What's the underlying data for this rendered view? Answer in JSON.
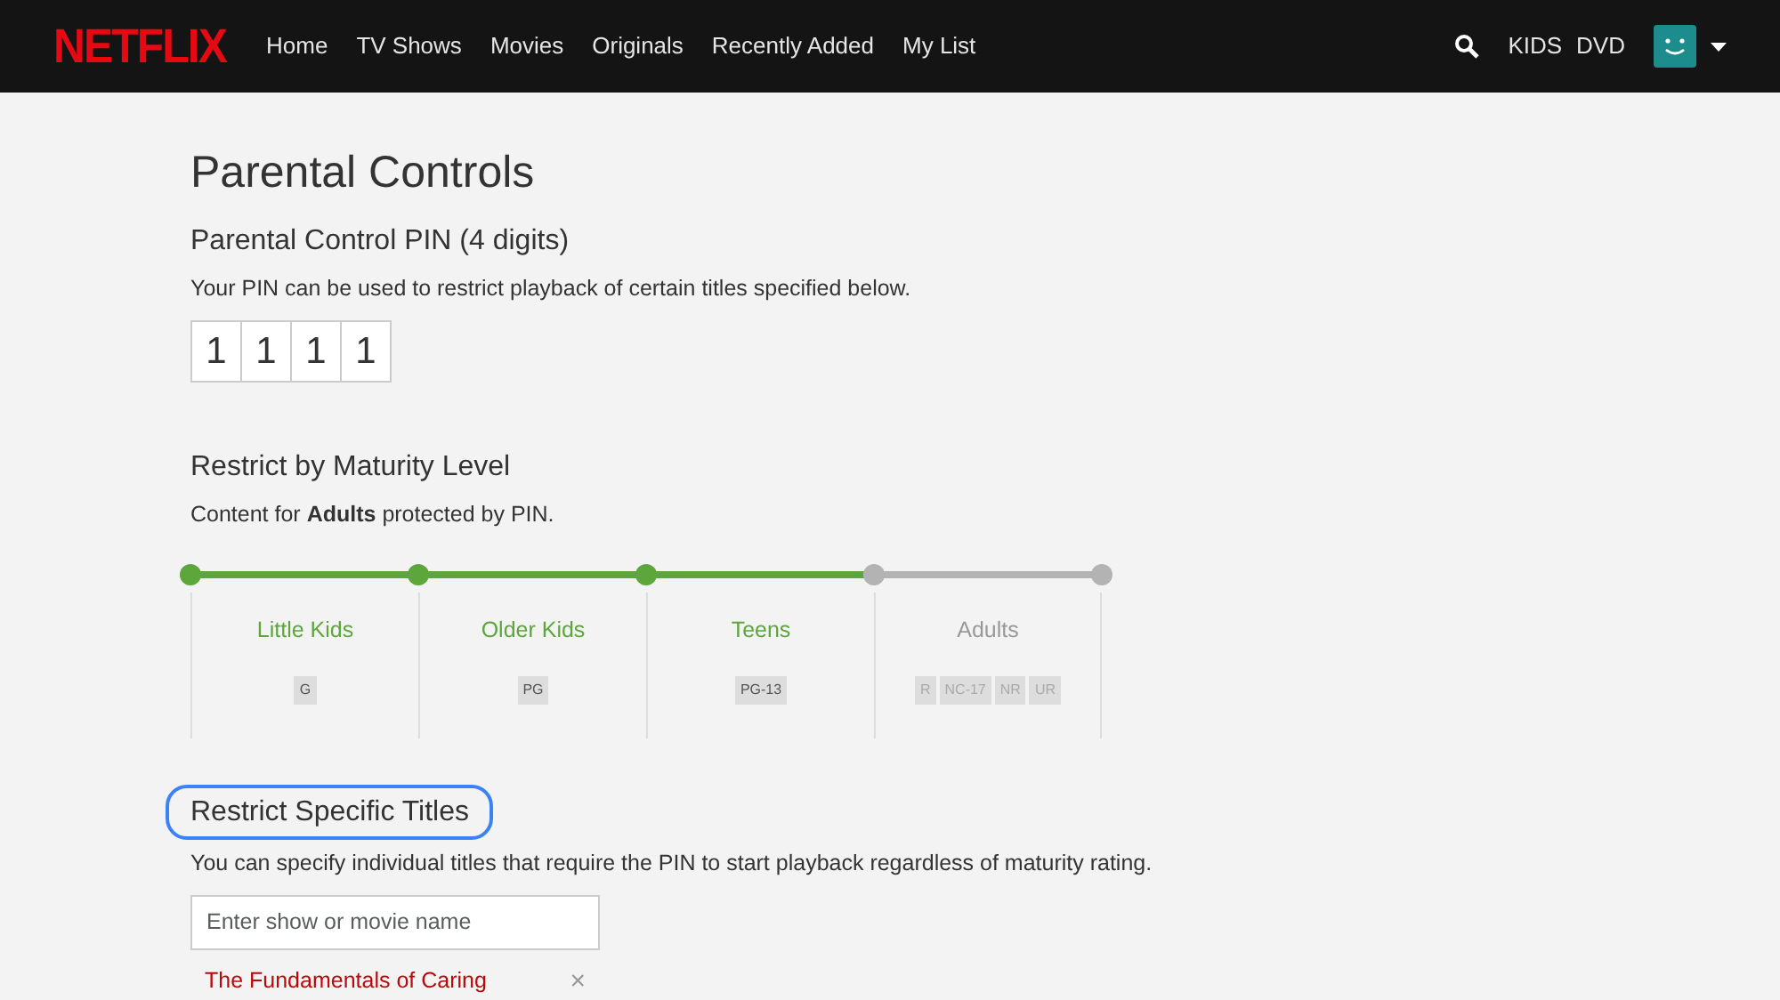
{
  "header": {
    "logo": "NETFLIX",
    "nav": [
      "Home",
      "TV Shows",
      "Movies",
      "Originals",
      "Recently Added",
      "My List"
    ],
    "right_links": [
      "KIDS",
      "DVD"
    ]
  },
  "page_title": "Parental Controls",
  "pin": {
    "heading": "Parental Control PIN (4 digits)",
    "description": "Your PIN can be used to restrict playback of certain titles specified below.",
    "digits": [
      "1",
      "1",
      "1",
      "1"
    ]
  },
  "maturity": {
    "heading": "Restrict by Maturity Level",
    "description": "Content for **Adults** protected by PIN.",
    "levels": [
      {
        "label": "Little Kids",
        "ratings": [
          "G"
        ],
        "allowed": true
      },
      {
        "label": "Older Kids",
        "ratings": [
          "PG"
        ],
        "allowed": true
      },
      {
        "label": "Teens",
        "ratings": [
          "PG-13"
        ],
        "allowed": true
      },
      {
        "label": "Adults",
        "ratings": [
          "R",
          "NC-17",
          "NR",
          "UR"
        ],
        "allowed": false
      }
    ]
  },
  "specific_titles": {
    "heading": "Restrict Specific Titles",
    "highlighted": true,
    "description": "You can specify individual titles that require the PIN to start playback regardless of maturity rating.",
    "search": {
      "placeholder": "Enter show or movie name"
    },
    "titles": [
      {
        "name": "The Fundamentals of Caring",
        "remove": "×"
      }
    ]
  }
}
